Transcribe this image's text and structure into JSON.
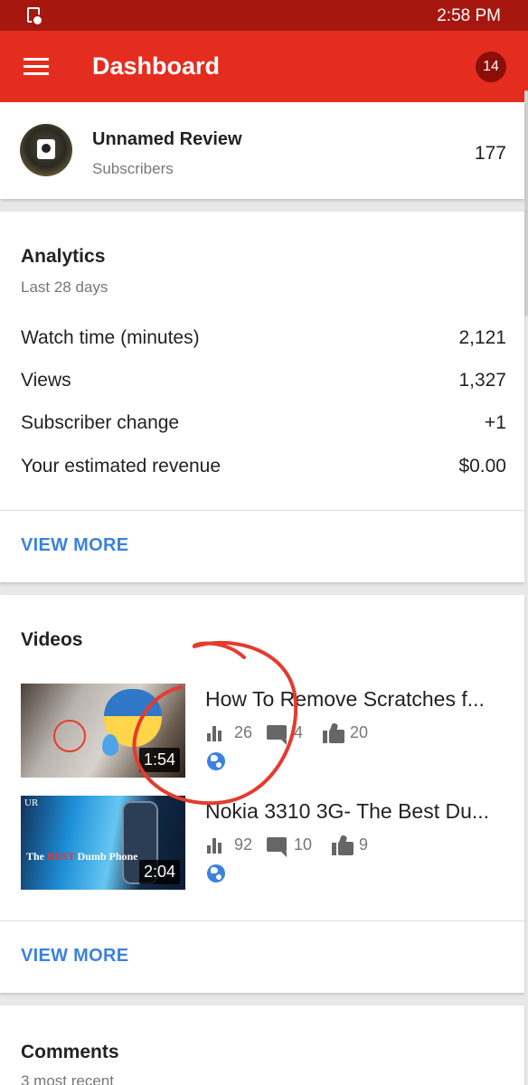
{
  "status_bar": {
    "time": "2:58 PM"
  },
  "app_bar": {
    "title": "Dashboard",
    "notification_count": "14"
  },
  "channel": {
    "name": "Unnamed Review",
    "subscribers_label": "Subscribers",
    "subscriber_count": "177"
  },
  "analytics": {
    "title": "Analytics",
    "period": "Last 28 days",
    "metrics": [
      {
        "label": "Watch time (minutes)",
        "value": "2,121"
      },
      {
        "label": "Views",
        "value": "1,327"
      },
      {
        "label": "Subscriber change",
        "value": "+1"
      },
      {
        "label": "Your estimated revenue",
        "value": "$0.00"
      }
    ],
    "view_more": "VIEW MORE"
  },
  "videos": {
    "title": "Videos",
    "items": [
      {
        "title": "How To Remove Scratches f...",
        "duration": "1:54",
        "views": "26",
        "comments": "4",
        "likes": "20",
        "visibility_icon": "globe-icon"
      },
      {
        "title": "Nokia 3310 3G- The Best Du...",
        "duration": "2:04",
        "views": "92",
        "comments": "10",
        "likes": "9",
        "visibility_icon": "globe-icon",
        "thumb_text_a": "The ",
        "thumb_text_b": "BEST",
        "thumb_text_c": " Dumb Phone",
        "thumb_logo": "UR"
      }
    ],
    "view_more": "VIEW MORE"
  },
  "comments": {
    "title": "Comments",
    "subtitle": "3 most recent"
  },
  "colors": {
    "status_bar": "#a6170f",
    "app_bar": "#e52d1f",
    "badge": "#8b0e08",
    "link": "#3b82e0",
    "annotation": "#e43b2f"
  }
}
